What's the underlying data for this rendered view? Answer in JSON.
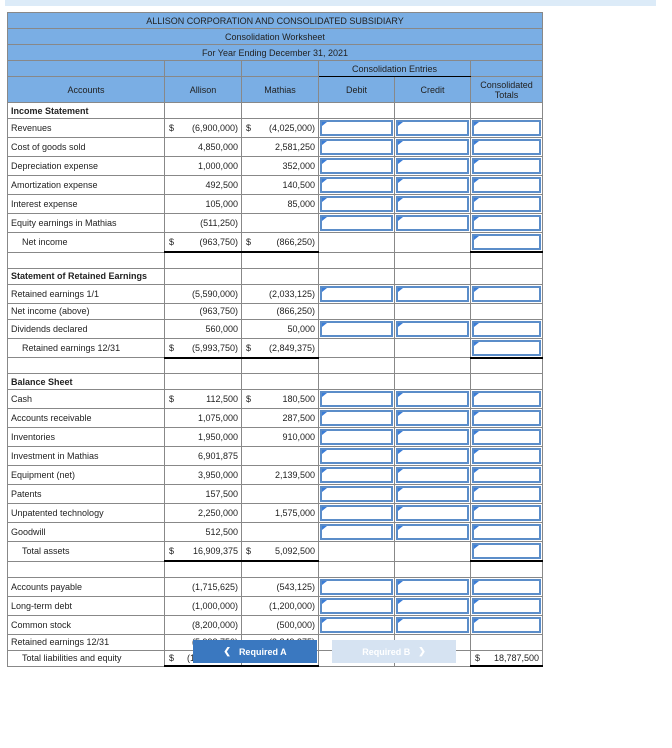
{
  "header": {
    "company": "ALLISON CORPORATION AND CONSOLIDATED SUBSIDIARY",
    "title": "Consolidation Worksheet",
    "period": "For Year Ending December 31, 2021",
    "entries": "Consolidation Entries",
    "accounts": "Accounts",
    "allison": "Allison",
    "mathias": "Mathias",
    "debit": "Debit",
    "credit": "Credit",
    "totals": "Consolidated Totals"
  },
  "rows": [
    {
      "type": "section",
      "label": "Income Statement"
    },
    {
      "type": "input",
      "label": "Revenues",
      "allison": "(6,900,000)",
      "allison_cur": "$",
      "mathias": "(4,025,000)",
      "mathias_cur": "$"
    },
    {
      "type": "input",
      "label": "Cost of goods sold",
      "allison": "4,850,000",
      "mathias": "2,581,250"
    },
    {
      "type": "input",
      "label": "Depreciation expense",
      "allison": "1,000,000",
      "mathias": "352,000"
    },
    {
      "type": "input",
      "label": "Amortization expense",
      "allison": "492,500",
      "mathias": "140,500"
    },
    {
      "type": "input",
      "label": "Interest expense",
      "allison": "105,000",
      "mathias": "85,000"
    },
    {
      "type": "input",
      "label": "Equity earnings in Mathias",
      "allison": "(511,250)",
      "mathias": ""
    },
    {
      "type": "total",
      "label": "Net income",
      "allison": "(963,750)",
      "allison_cur": "$",
      "mathias": "(866,250)",
      "mathias_cur": "$"
    },
    {
      "type": "blank"
    },
    {
      "type": "section",
      "label": "Statement of Retained Earnings"
    },
    {
      "type": "input",
      "label": "Retained earnings 1/1",
      "allison": "(5,590,000)",
      "mathias": "(2,033,125)"
    },
    {
      "type": "plain",
      "label": "Net income (above)",
      "allison": "(963,750)",
      "mathias": "(866,250)"
    },
    {
      "type": "input",
      "label": "Dividends declared",
      "allison": "560,000",
      "mathias": "50,000"
    },
    {
      "type": "total",
      "label": "Retained earnings 12/31",
      "allison": "(5,993,750)",
      "allison_cur": "$",
      "mathias": "(2,849,375)",
      "mathias_cur": "$"
    },
    {
      "type": "blank"
    },
    {
      "type": "section",
      "label": "Balance Sheet"
    },
    {
      "type": "input",
      "label": "Cash",
      "allison": "112,500",
      "allison_cur": "$",
      "mathias": "180,500",
      "mathias_cur": "$"
    },
    {
      "type": "input",
      "label": "Accounts receivable",
      "allison": "1,075,000",
      "mathias": "287,500"
    },
    {
      "type": "input",
      "label": "Inventories",
      "allison": "1,950,000",
      "mathias": "910,000"
    },
    {
      "type": "input",
      "label": "Investment in Mathias",
      "allison": "6,901,875",
      "mathias": ""
    },
    {
      "type": "input",
      "label": "Equipment (net)",
      "allison": "3,950,000",
      "mathias": "2,139,500"
    },
    {
      "type": "input",
      "label": "Patents",
      "allison": "157,500",
      "mathias": ""
    },
    {
      "type": "input",
      "label": "Unpatented technology",
      "allison": "2,250,000",
      "mathias": "1,575,000"
    },
    {
      "type": "input",
      "label": "Goodwill",
      "allison": "512,500",
      "mathias": ""
    },
    {
      "type": "total",
      "label": "Total assets",
      "allison": "16,909,375",
      "allison_cur": "$",
      "mathias": "5,092,500",
      "mathias_cur": "$"
    },
    {
      "type": "blank"
    },
    {
      "type": "input",
      "label": "Accounts payable",
      "allison": "(1,715,625)",
      "mathias": "(543,125)"
    },
    {
      "type": "input",
      "label": "Long-term debt",
      "allison": "(1,000,000)",
      "mathias": "(1,200,000)"
    },
    {
      "type": "input",
      "label": "Common stock",
      "allison": "(8,200,000)",
      "mathias": "(500,000)"
    },
    {
      "type": "plain",
      "label": "Retained earnings 12/31",
      "allison": "(5,993,750)",
      "mathias": "(2,849,375)"
    },
    {
      "type": "total",
      "label": "Total liabilities and equity",
      "allison": "(16,909,375)",
      "allison_cur": "$",
      "mathias": "(5,092,500)",
      "mathias_cur": "$",
      "total": "18,787,500",
      "total_cur": "$"
    }
  ],
  "nav": {
    "prev": "Required A",
    "next": "Required B"
  }
}
